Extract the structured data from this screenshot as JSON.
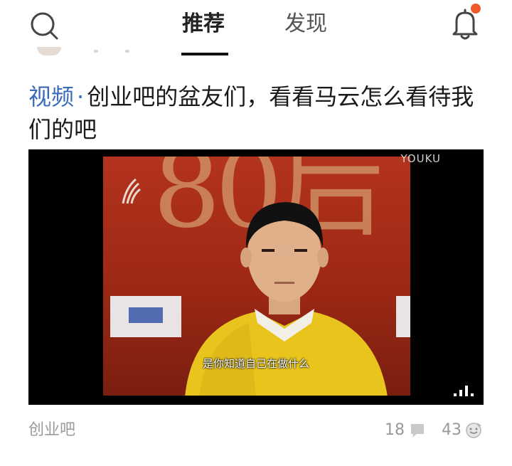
{
  "header": {
    "tabs": [
      {
        "label": "推荐",
        "active": true
      },
      {
        "label": "发现",
        "active": false
      }
    ],
    "search_icon": "search-icon",
    "bell_icon": "bell-icon",
    "notification_dot_color": "#f05a28"
  },
  "article": {
    "category": "视频",
    "separator": "·",
    "title": "创业吧的盆友们，看看马云怎么看待我们的吧",
    "video": {
      "watermark": "YOUKU",
      "subtitle": "是你知道自己在做什么",
      "stage_text": "80后"
    },
    "source": "创业吧",
    "comments": "18",
    "likes": "43"
  },
  "colors": {
    "category": "#3b6ab8",
    "meta_text": "#9a9a9a",
    "active_tab": "#222222"
  }
}
